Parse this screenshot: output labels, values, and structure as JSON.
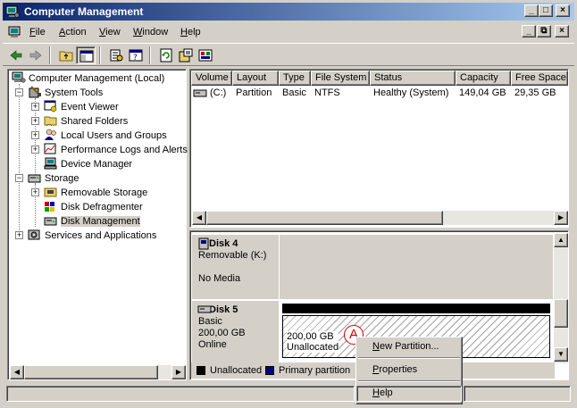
{
  "window": {
    "title": "Computer Management"
  },
  "menu": {
    "items": [
      {
        "label": "File",
        "accel": "F",
        "rest": "ile"
      },
      {
        "label": "Action",
        "accel": "A",
        "rest": "ction"
      },
      {
        "label": "View",
        "accel": "V",
        "rest": "iew"
      },
      {
        "label": "Window",
        "accel": "W",
        "rest": "indow"
      },
      {
        "label": "Help",
        "accel": "H",
        "rest": "elp"
      }
    ]
  },
  "tree": {
    "root": "Computer Management (Local)",
    "system_tools": "System Tools",
    "event_viewer": "Event Viewer",
    "shared_folders": "Shared Folders",
    "local_users": "Local Users and Groups",
    "perf_logs": "Performance Logs and Alerts",
    "device_manager": "Device Manager",
    "storage": "Storage",
    "removable_storage": "Removable Storage",
    "disk_defrag": "Disk Defragmenter",
    "disk_management": "Disk Management",
    "services": "Services and Applications"
  },
  "volumes": {
    "columns": [
      "Volume",
      "Layout",
      "Type",
      "File System",
      "Status",
      "Capacity",
      "Free Space"
    ],
    "rows": [
      {
        "volume": "(C:)",
        "layout": "Partition",
        "type": "Basic",
        "fs": "NTFS",
        "status": "Healthy (System)",
        "capacity": "149,04 GB",
        "free": "29,35 GB"
      }
    ]
  },
  "disks": {
    "disk4": {
      "name": "Disk 4",
      "type": "Removable (K:)",
      "media": "No Media"
    },
    "disk5": {
      "name": "Disk 5",
      "type": "Basic",
      "size": "200,00 GB",
      "state": "Online",
      "partition_size": "200,00 GB",
      "partition_label": "Unallocated"
    }
  },
  "annotation": {
    "label": "A",
    "color": "#d40000"
  },
  "legend": {
    "unallocated": "Unallocated",
    "unallocated_color": "#000000",
    "primary": "Primary partition",
    "primary_color": "#000080"
  },
  "context_menu": {
    "new_partition": {
      "accel": "N",
      "rest": "ew Partition..."
    },
    "properties": {
      "accel": "P",
      "rest": "roperties"
    },
    "help": {
      "accel": "H",
      "rest": "elp"
    }
  }
}
